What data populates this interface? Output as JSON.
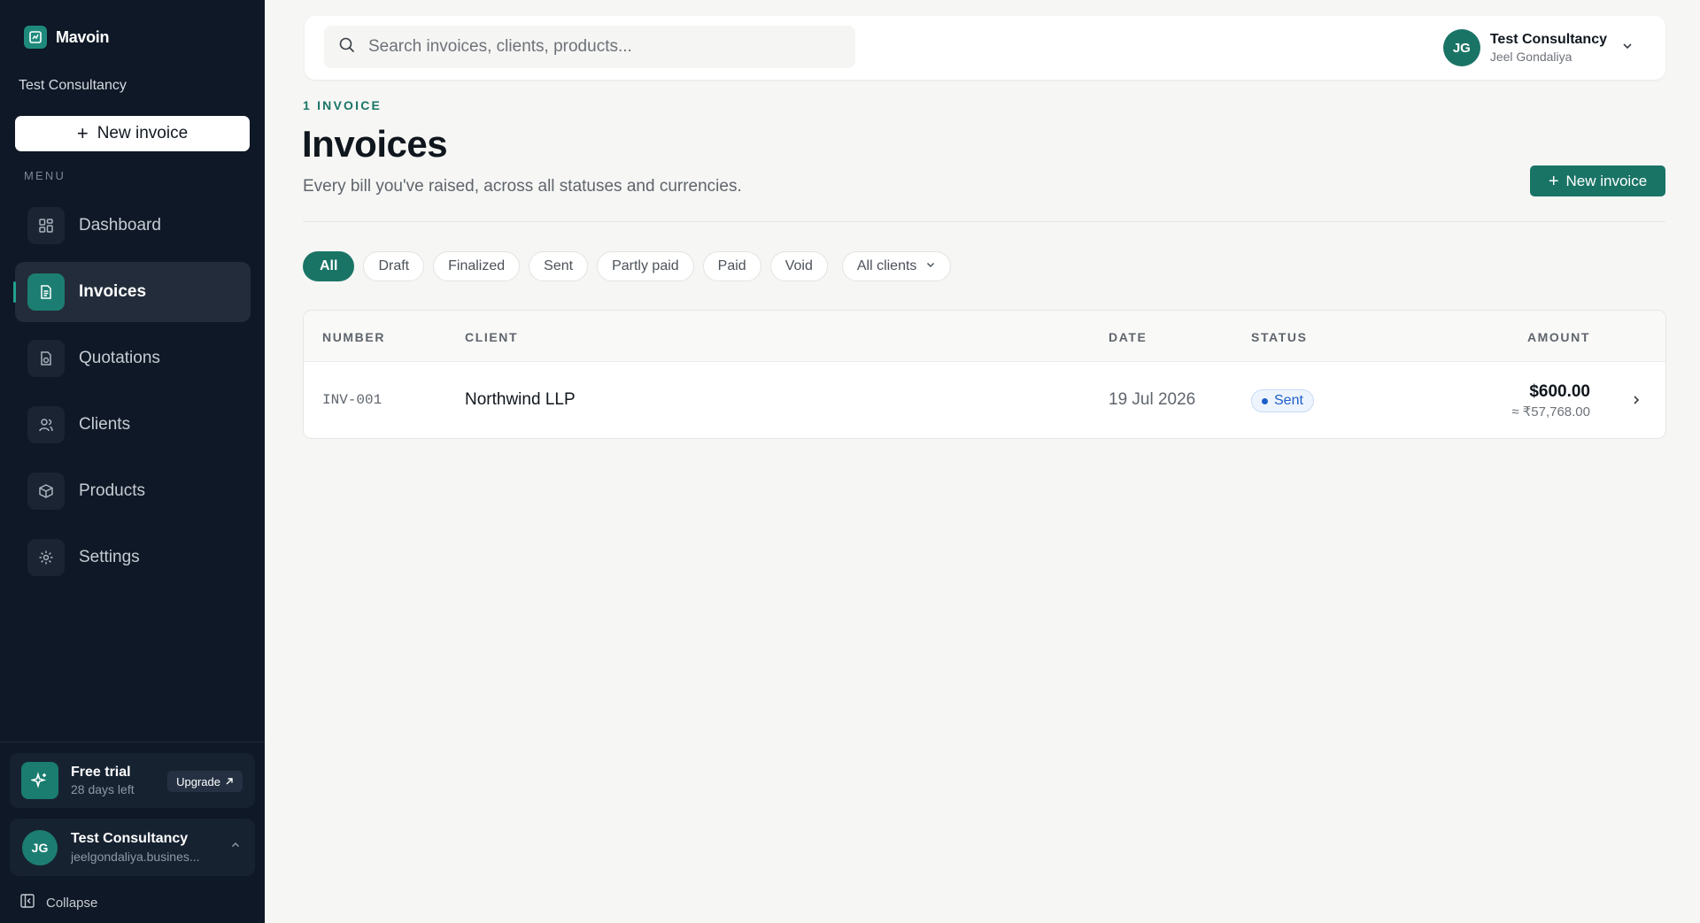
{
  "brand": {
    "name": "Mavoin"
  },
  "sidebar": {
    "org": "Test Consultancy",
    "new_invoice": "New invoice",
    "menu_label": "MENU",
    "items": [
      {
        "label": "Dashboard",
        "icon": "dashboard-icon"
      },
      {
        "label": "Invoices",
        "icon": "invoice-icon",
        "active": true
      },
      {
        "label": "Quotations",
        "icon": "quotation-icon"
      },
      {
        "label": "Clients",
        "icon": "users-icon"
      },
      {
        "label": "Products",
        "icon": "box-icon"
      },
      {
        "label": "Settings",
        "icon": "gear-icon"
      }
    ],
    "trial": {
      "title": "Free trial",
      "days": "28 days left",
      "upgrade": "Upgrade"
    },
    "account": {
      "initials": "JG",
      "name": "Test Consultancy",
      "email": "jeelgondaliya.busines..."
    },
    "collapse": "Collapse"
  },
  "topbar": {
    "search_placeholder": "Search invoices, clients, products...",
    "user": {
      "initials": "JG",
      "org": "Test Consultancy",
      "name": "Jeel Gondaliya"
    }
  },
  "page": {
    "eyebrow": "1 INVOICE",
    "title": "Invoices",
    "subtitle": "Every bill you've raised, across all statuses and currencies.",
    "new_invoice": "New invoice"
  },
  "filters": {
    "chips": [
      "All",
      "Draft",
      "Finalized",
      "Sent",
      "Partly paid",
      "Paid",
      "Void"
    ],
    "active": "All",
    "client_select": "All clients"
  },
  "table": {
    "headers": {
      "number": "NUMBER",
      "client": "CLIENT",
      "date": "DATE",
      "status": "STATUS",
      "amount": "AMOUNT"
    },
    "rows": [
      {
        "number": "INV-001",
        "client": "Northwind LLP",
        "date": "19 Jul 2026",
        "status": "Sent",
        "amount": "$600.00",
        "converted": "≈ ₹57,768.00"
      }
    ]
  },
  "colors": {
    "accent": "#1a7466",
    "sidebar_bg": "#0f1826",
    "status_sent": "#1d5fc8"
  }
}
